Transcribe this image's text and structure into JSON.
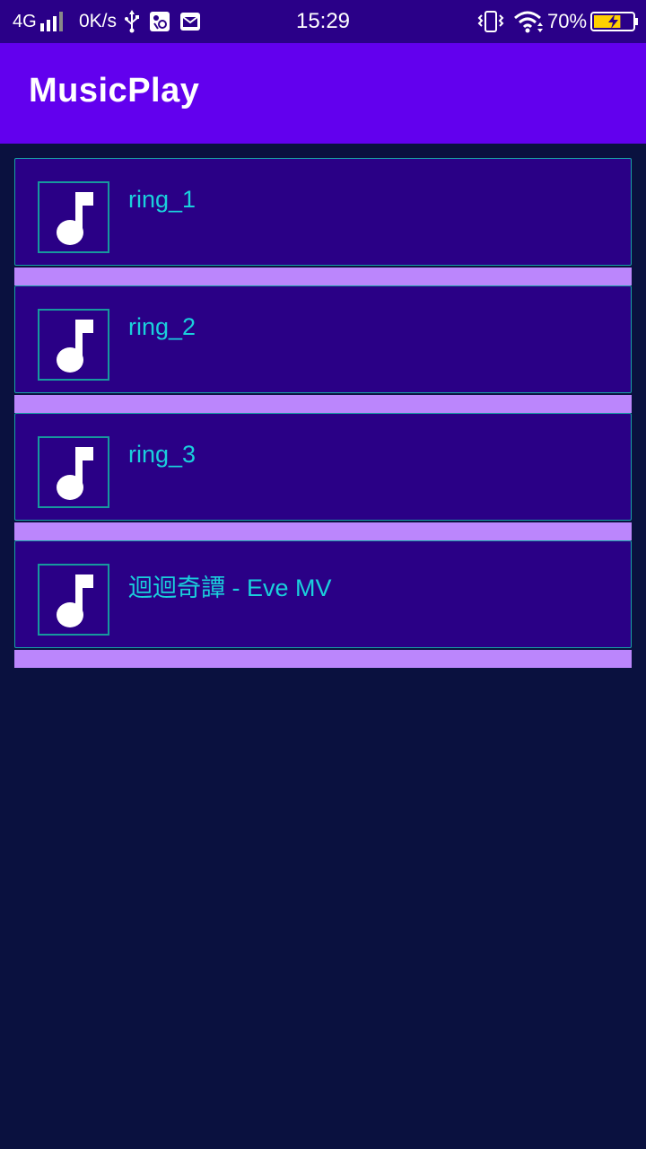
{
  "status_bar": {
    "network": "4G",
    "net_speed": "0K/s",
    "time": "15:29",
    "battery_percent": "70%",
    "battery_level": 0.7,
    "icons": [
      "signal-icon",
      "usb-icon",
      "app-notification-icon",
      "mail-notification-icon",
      "vibrate-icon",
      "wifi-icon",
      "battery-charging-icon"
    ]
  },
  "app_bar": {
    "title": "MusicPlay"
  },
  "songs": [
    {
      "title": "ring_1",
      "icon": "music-note-icon"
    },
    {
      "title": "ring_2",
      "icon": "music-note-icon"
    },
    {
      "title": "ring_3",
      "icon": "music-note-icon"
    },
    {
      "title": "迴迴奇譚 - Eve MV",
      "icon": "music-note-icon"
    }
  ],
  "colors": {
    "status_bar_bg": "#2a0088",
    "app_bar_bg": "#6200ee",
    "page_bg": "#0a113f",
    "card_bg": "#2a0086",
    "card_border": "#17a2a6",
    "title_text": "#1ad0dc",
    "divider": "#bb86fc"
  }
}
